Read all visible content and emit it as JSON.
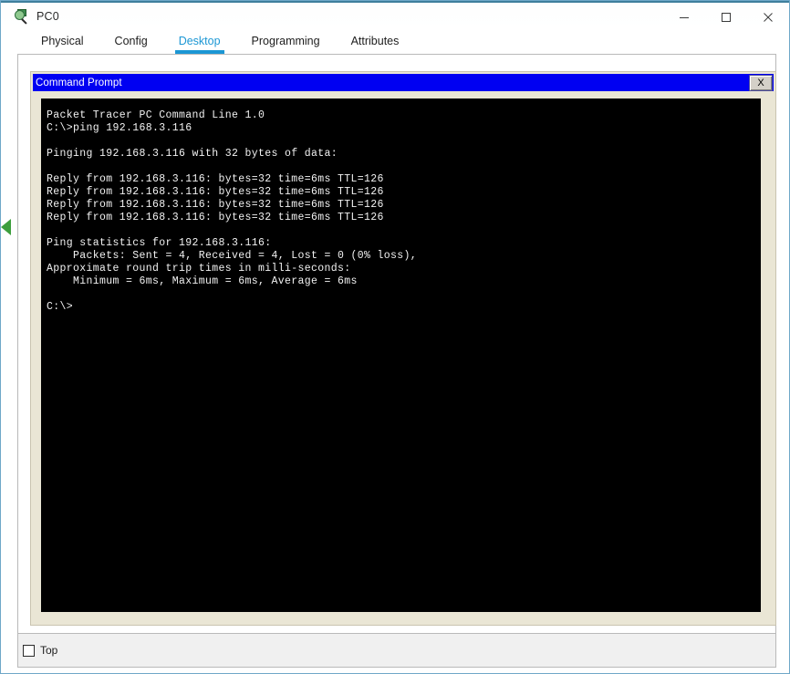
{
  "window": {
    "title": "PC0",
    "icon": "packet-tracer-device-icon",
    "controls": {
      "minimize": "minimize-icon",
      "maximize": "maximize-icon",
      "close": "close-icon"
    }
  },
  "tabs": [
    {
      "label": "Physical",
      "active": false
    },
    {
      "label": "Config",
      "active": false
    },
    {
      "label": "Desktop",
      "active": true
    },
    {
      "label": "Programming",
      "active": false
    },
    {
      "label": "Attributes",
      "active": false
    }
  ],
  "command_prompt": {
    "title": "Command Prompt",
    "close_label": "X",
    "terminal_text": "Packet Tracer PC Command Line 1.0\nC:\\>ping 192.168.3.116\n\nPinging 192.168.3.116 with 32 bytes of data:\n\nReply from 192.168.3.116: bytes=32 time=6ms TTL=126\nReply from 192.168.3.116: bytes=32 time=6ms TTL=126\nReply from 192.168.3.116: bytes=32 time=6ms TTL=126\nReply from 192.168.3.116: bytes=32 time=6ms TTL=126\n\nPing statistics for 192.168.3.116:\n    Packets: Sent = 4, Received = 4, Lost = 0 (0% loss),\nApproximate round trip times in milli-seconds:\n    Minimum = 6ms, Maximum = 6ms, Average = 6ms\n\nC:\\>",
    "terminal_lines": [
      "Packet Tracer PC Command Line 1.0",
      "C:\\>ping 192.168.3.116",
      "",
      "Pinging 192.168.3.116 with 32 bytes of data:",
      "",
      "Reply from 192.168.3.116: bytes=32 time=6ms TTL=126",
      "Reply from 192.168.3.116: bytes=32 time=6ms TTL=126",
      "Reply from 192.168.3.116: bytes=32 time=6ms TTL=126",
      "Reply from 192.168.3.116: bytes=32 time=6ms TTL=126",
      "",
      "Ping statistics for 192.168.3.116:",
      "    Packets: Sent = 4, Received = 4, Lost = 0 (0% loss),",
      "Approximate round trip times in milli-seconds:",
      "    Minimum = 6ms, Maximum = 6ms, Average = 6ms",
      "",
      "C:\\>"
    ]
  },
  "footer": {
    "top_checkbox_label": "Top",
    "top_checkbox_checked": false
  },
  "colors": {
    "accent": "#1c97d4",
    "cmd_titlebar": "#0000f2",
    "terminal_bg": "#000000",
    "terminal_fg": "#f2f2f2",
    "window_border": "#6fa8c8",
    "marker_green": "#3d9e3d"
  }
}
